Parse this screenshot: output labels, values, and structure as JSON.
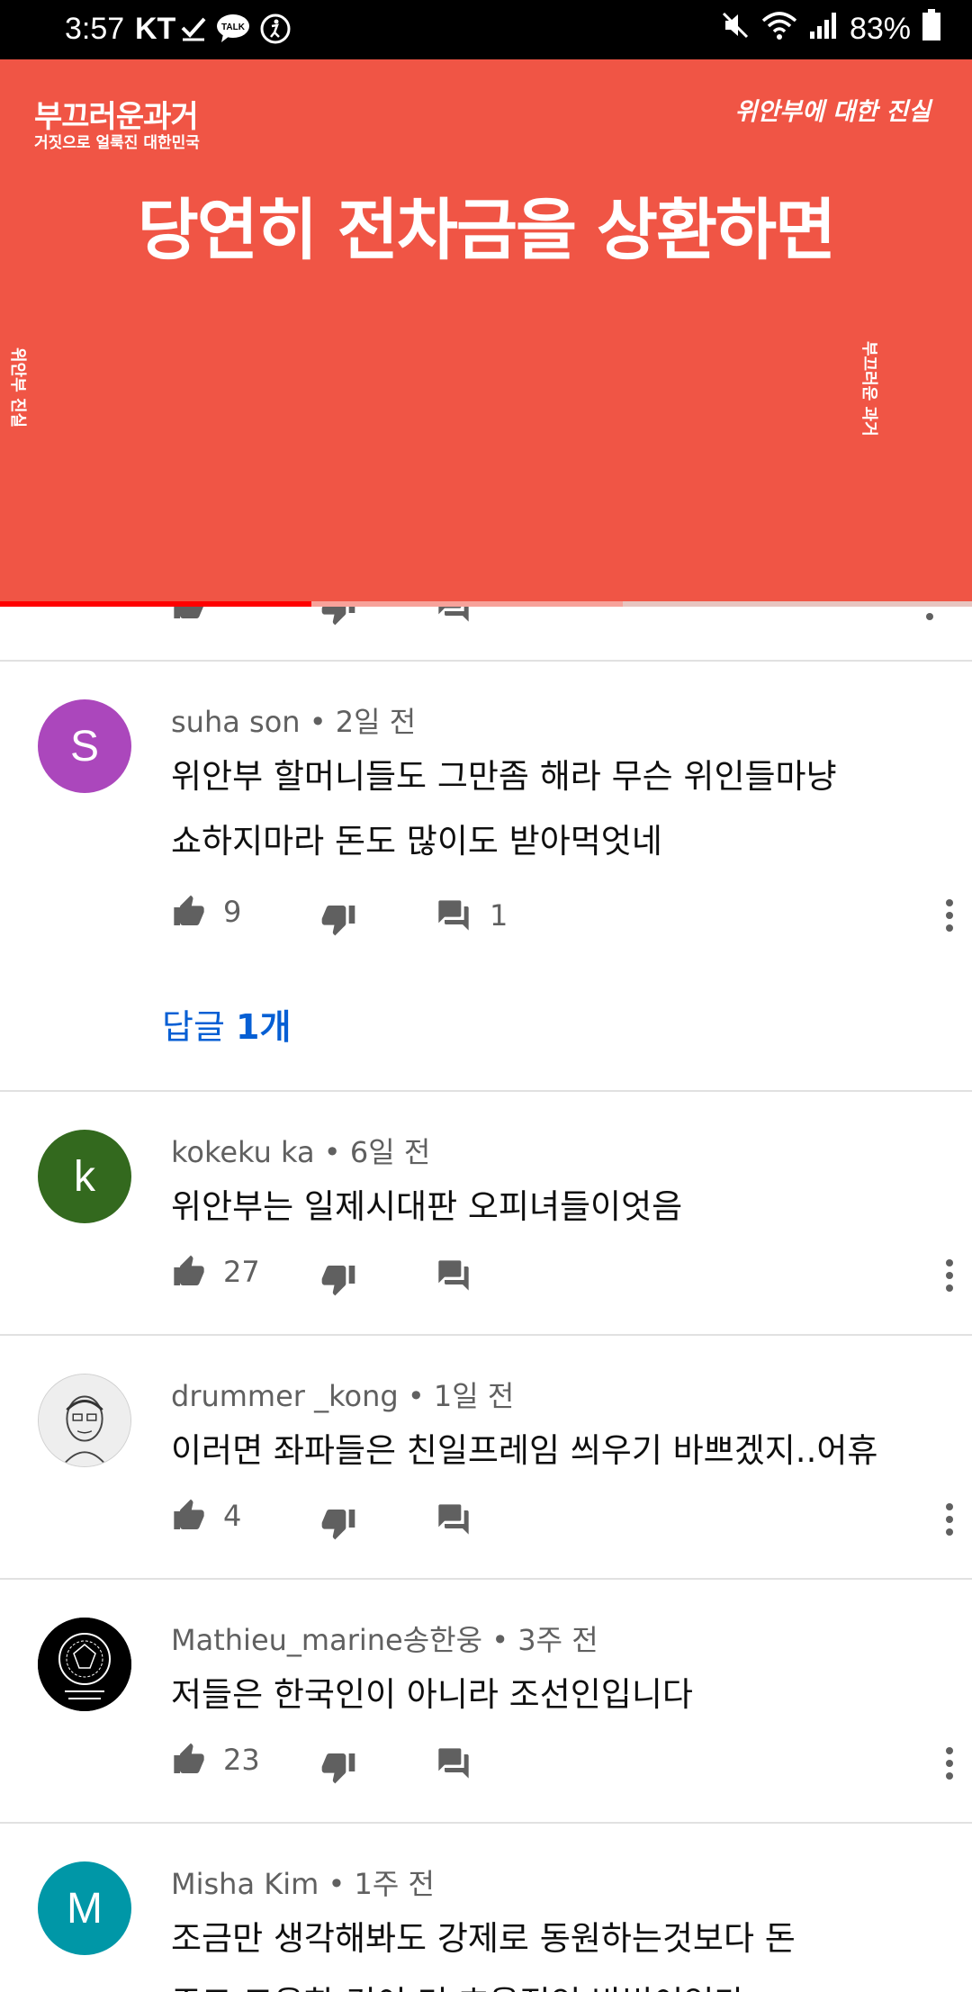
{
  "status_bar": {
    "time": "3:57",
    "carrier": "KT",
    "battery": "83%",
    "icons": [
      "check-icon",
      "talk-icon",
      "accessibility-icon",
      "mute-icon",
      "wifi-icon",
      "signal-icon",
      "battery-icon"
    ]
  },
  "video": {
    "logo_title": "부끄러운과거",
    "logo_subtitle": "거짓으로 얼룩진 대한민국",
    "corner_text": "위안부에 대한 진실",
    "headline": "당연히 전차금을 상환하면",
    "side_left": "위안부 진실",
    "side_right": "부끄러운 과거",
    "background": "#f05545",
    "progress": 0.32,
    "buffered": 0.64
  },
  "comments": [
    {
      "author": "suha son",
      "time": "2일 전",
      "avatar_letter": "S",
      "avatar_color": "#ab47bc",
      "lines": [
        "위안부 할머니들도 그만좀 해라 무슨 위인들마냥",
        "쇼하지마라 돈도 많이도 받아먹엇네"
      ],
      "likes": "9",
      "replies_count": "1",
      "replies_link_prefix": "답글 ",
      "replies_link_count": "1개"
    },
    {
      "author": "kokeku ka",
      "time": "6일 전",
      "avatar_letter": "k",
      "avatar_color": "#33691e",
      "lines": [
        "위안부는 일제시대판 오피녀들이엇음"
      ],
      "likes": "27"
    },
    {
      "author": "drummer _kong",
      "time": "1일 전",
      "avatar_letter": "",
      "avatar_color": "#eeeeee",
      "lines": [
        "이러면 좌파들은 친일프레임 씌우기 바쁘겠지..어휴"
      ],
      "likes": "4"
    },
    {
      "author": "Mathieu_marine송한웅",
      "time": "3주 전",
      "avatar_letter": "",
      "avatar_color": "#000000",
      "lines": [
        "저들은 한국인이 아니라 조선인입니다"
      ],
      "likes": "23"
    },
    {
      "author": "Misha Kim",
      "time": "1주 전",
      "avatar_letter": "M",
      "avatar_color": "#0097a7",
      "lines": [
        "조금만 생각해봐도 강제로 동원하는것보다 돈",
        "주고 고용한 것이 더 효율적인 방법이었다"
      ],
      "likes": ""
    }
  ],
  "separator": " • "
}
